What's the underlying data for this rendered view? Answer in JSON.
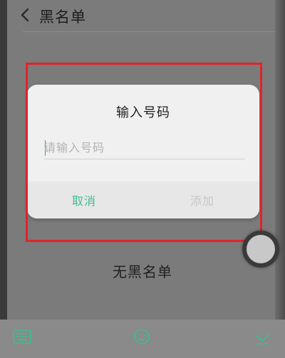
{
  "header": {
    "title": "黑名单",
    "back_icon": "chevron-left-icon"
  },
  "dialog": {
    "title": "输入号码",
    "input": {
      "placeholder": "请输入号码",
      "value": ""
    },
    "cancel_label": "取消",
    "add_label": "添加"
  },
  "empty_state": {
    "text": "无黑名单"
  },
  "toolbar": {
    "keyboard_icon": "keyboard-icon",
    "emoji_icon": "emoji-icon",
    "hide_icon": "hide-keyboard-icon"
  },
  "colors": {
    "highlight": "#e0242a",
    "accent": "#3dbd8e",
    "disabled": "#c7c7c7"
  }
}
